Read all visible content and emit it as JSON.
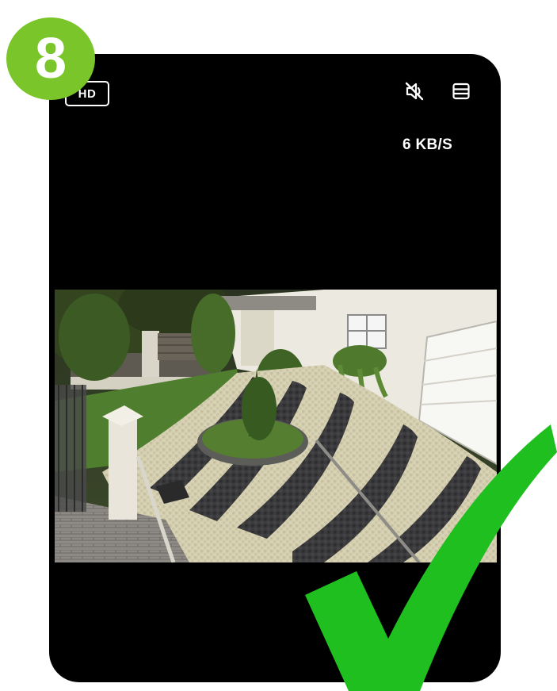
{
  "step": {
    "number": "8",
    "color": "#7ac52a"
  },
  "toolbar": {
    "hd_label": "HD",
    "mute_icon": "speaker-muted-icon",
    "menu_icon": "panel-menu-icon"
  },
  "stream": {
    "bitrate": "6 KB/S"
  },
  "overlay": {
    "checkmark_icon": "checkmark-icon",
    "checkmark_color": "#1fbf1f"
  },
  "colors": {
    "screen_bg": "#000000",
    "text": "#ffffff"
  }
}
